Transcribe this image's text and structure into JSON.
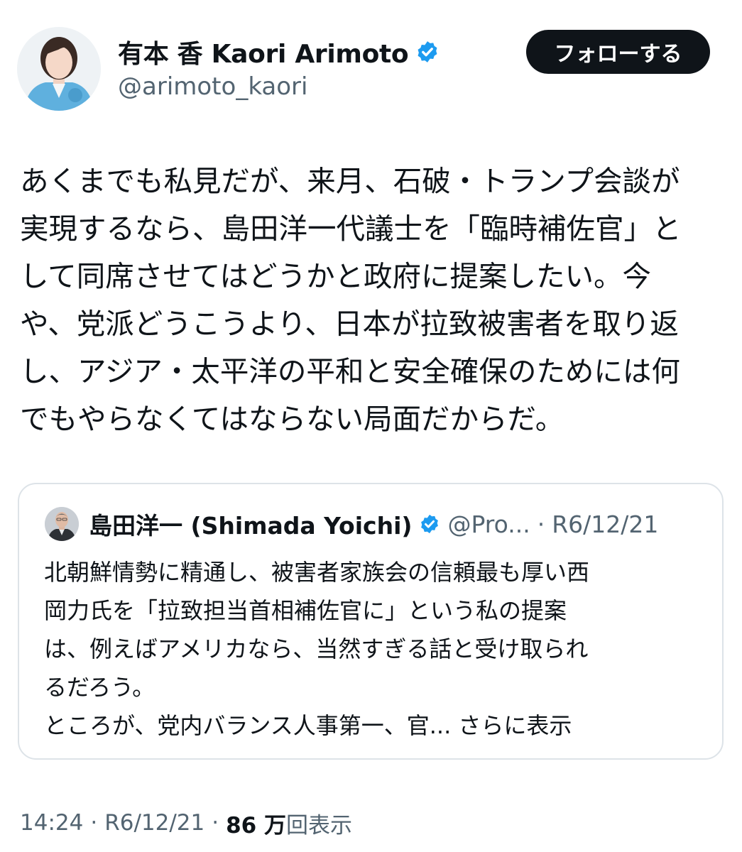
{
  "author": {
    "display_name": "有本 香 Kaori Arimoto",
    "handle": "@arimoto_kaori",
    "verified_color": "#1d9bf0"
  },
  "follow_button": {
    "label": "フォローする"
  },
  "tweet": {
    "lines": [
      "あくまでも私見だが、来月、石破・トランプ会談が",
      "実現するなら、島田洋一代議士を「臨時補佐官」と",
      "して同席させてはどうかと政府に提案したい。今",
      "や、党派どうこうより、日本が拉致被害者を取り返",
      "し、アジア・太平洋の平和と安全確保のためには何",
      "でもやらなくてはならない局面だからだ。"
    ]
  },
  "quote": {
    "display_name": "島田洋一 (Shimada Yoichi)",
    "handle": "@Pro...",
    "separator": "·",
    "date": "R6/12/21",
    "lines": [
      "北朝鮮情勢に精通し、被害者家族会の信頼最も厚い西",
      "岡力氏を「拉致担当首相補佐官に」という私の提案",
      "は、例えばアメリカなら、当然すぎる話と受け取られ",
      "るだろう。"
    ],
    "last_line": "ところが、党内バランス人事第一、官...",
    "show_more": "さらに表示"
  },
  "meta": {
    "time": "14:24",
    "sep1": "·",
    "date": "R6/12/21",
    "sep2": "·",
    "views_count": "86 万",
    "views_label": "回表示"
  }
}
